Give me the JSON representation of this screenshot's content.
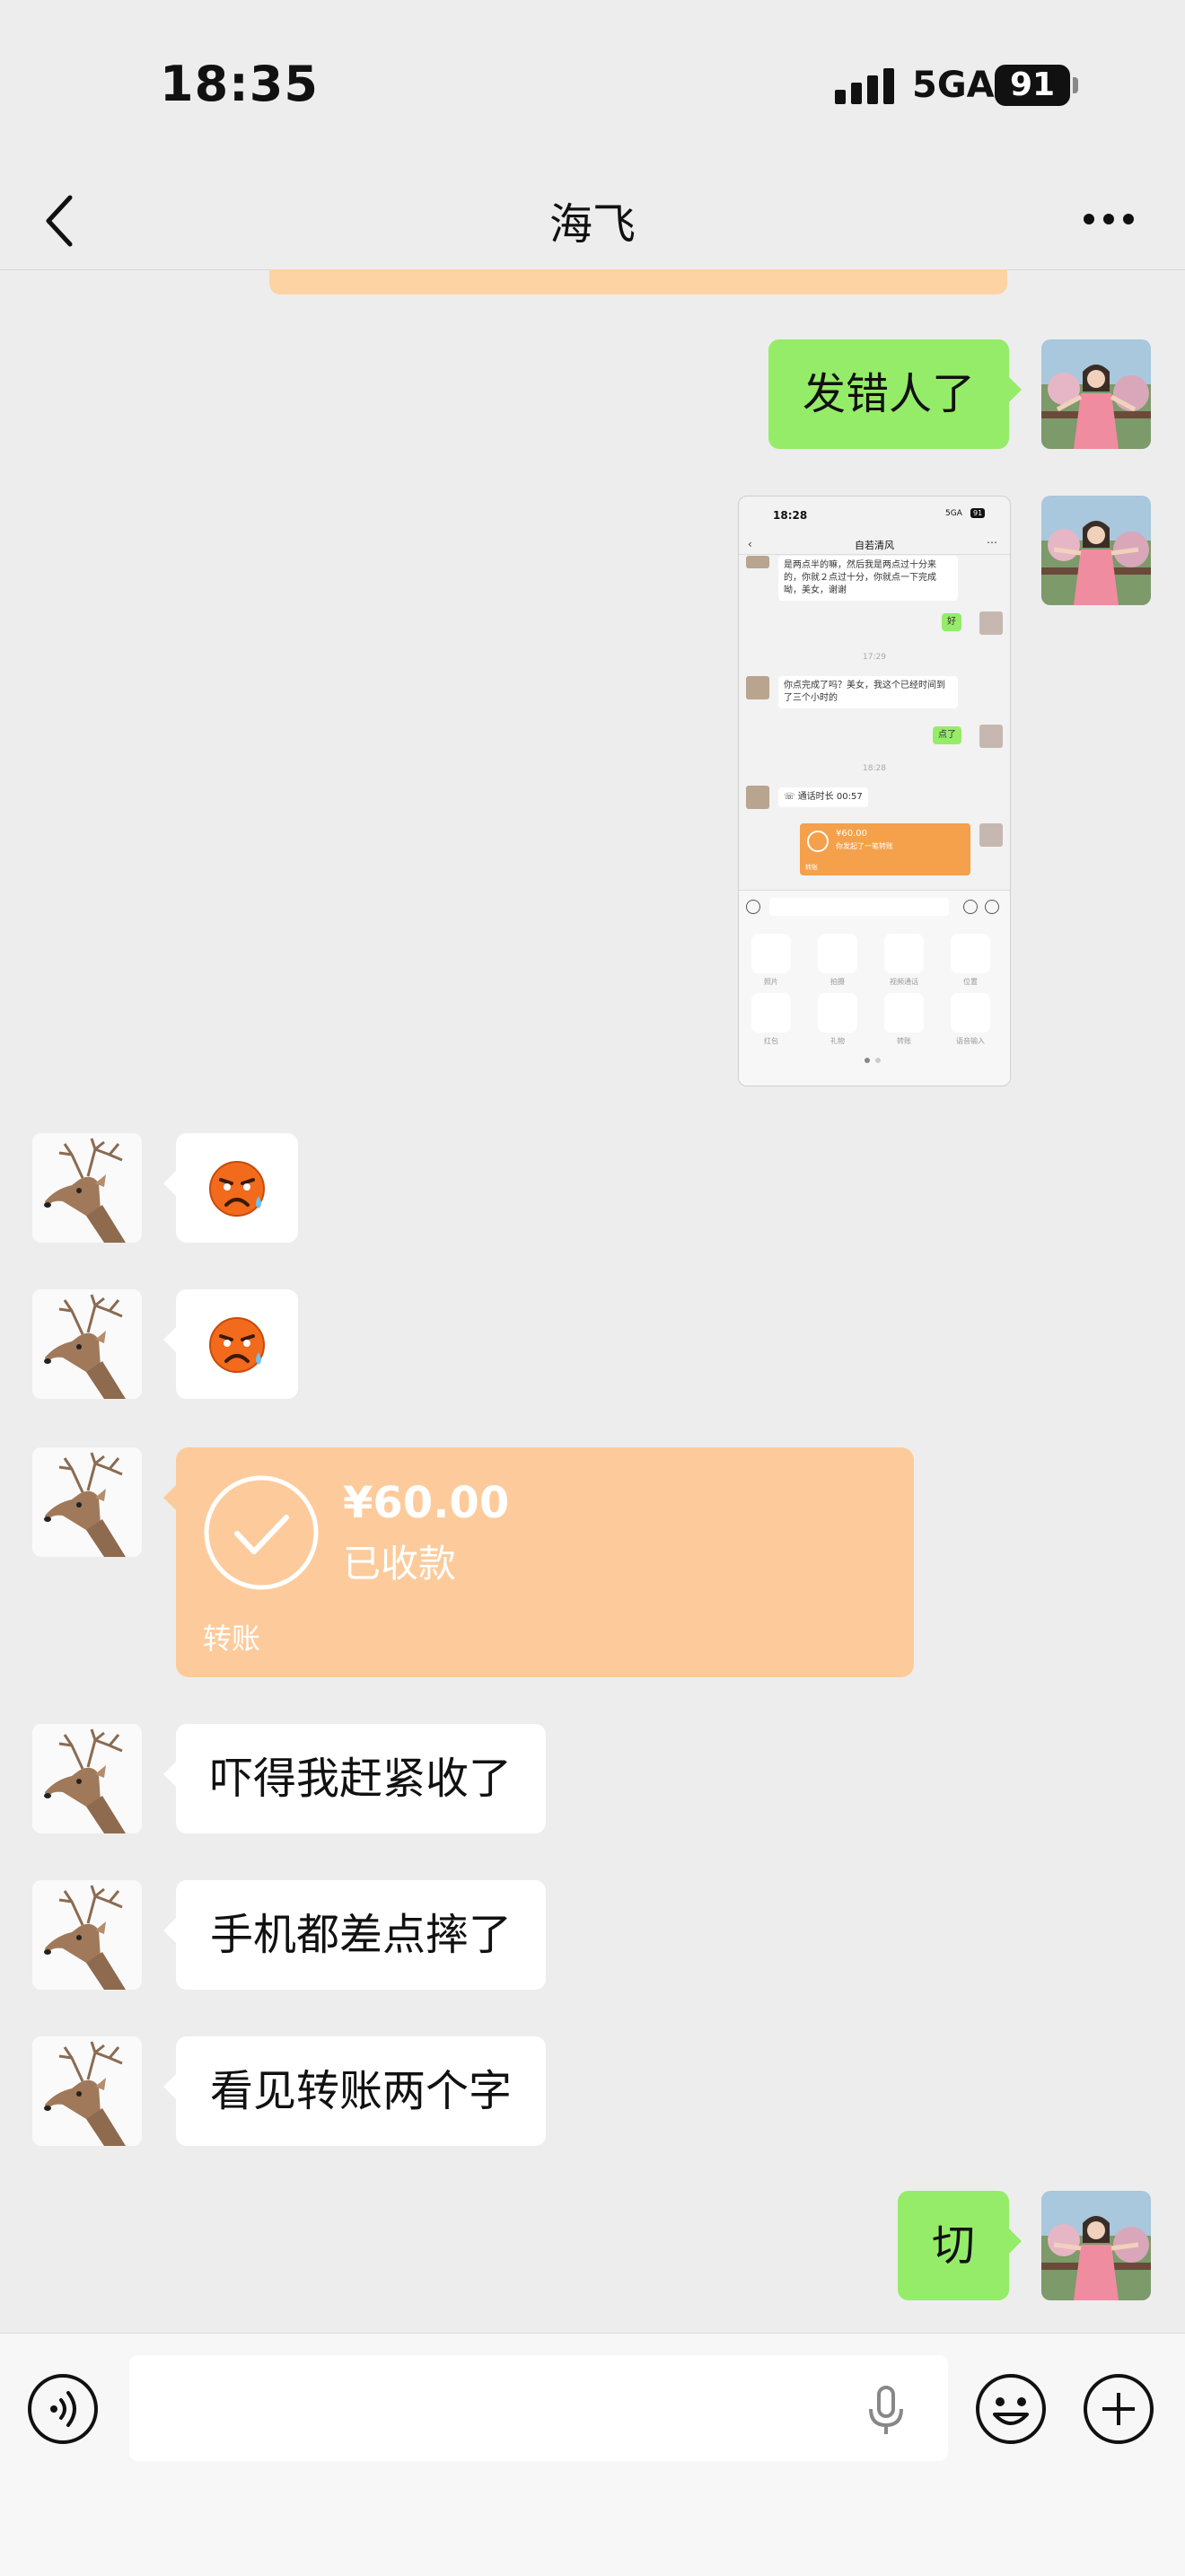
{
  "status_bar": {
    "time": "18:35",
    "network": "5GA",
    "battery": "91"
  },
  "header": {
    "title": "海飞"
  },
  "messages": [
    {
      "sender": "me",
      "type": "text",
      "text": "发错人了"
    },
    {
      "sender": "me",
      "type": "image"
    },
    {
      "sender": "other",
      "type": "emoji",
      "emoji": "crying-sweat-face"
    },
    {
      "sender": "other",
      "type": "emoji",
      "emoji": "crying-sweat-face"
    },
    {
      "sender": "other",
      "type": "transfer",
      "amount": "¥60.00",
      "status": "已收款",
      "label": "转账"
    },
    {
      "sender": "other",
      "type": "text",
      "text": "吓得我赶紧收了"
    },
    {
      "sender": "other",
      "type": "text",
      "text": "手机都差点摔了"
    },
    {
      "sender": "other",
      "type": "text",
      "text": "看见转账两个字"
    },
    {
      "sender": "me",
      "type": "text",
      "text": "切"
    }
  ],
  "screenshot": {
    "time": "18:28",
    "network": "5GA",
    "battery": "91",
    "title": "自若清风",
    "msg1": "是两点半的嘛，然后我是两点过十分来的，你就２点过十分，你就点一下完成呦，美女，谢谢",
    "reply1": "好",
    "ts1": "17:29",
    "msg2": "你点完成了吗？美女，我这个已经时间到了三个小时的",
    "reply2": "点了",
    "ts2": "18:28",
    "call": "通话时长 00:57",
    "transfer_amount": "¥60.00",
    "transfer_note": "你发起了一笔转账",
    "transfer_label": "转账",
    "panel": [
      "照片",
      "拍摄",
      "视频通话",
      "位置",
      "红包",
      "礼物",
      "转账",
      "语音输入"
    ]
  },
  "colors": {
    "self_bubble": "#95ec69",
    "transfer": "#fdcb9b",
    "background": "#ededed"
  }
}
